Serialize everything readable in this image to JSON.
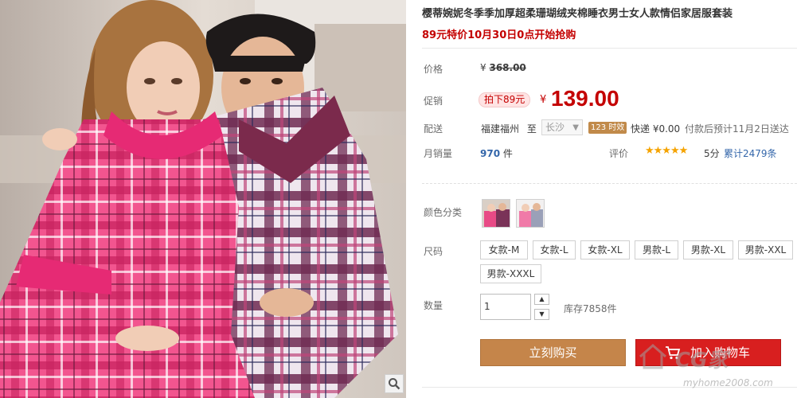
{
  "product": {
    "title": "樱蒂婉妮冬季季加厚超柔珊瑚绒夹棉睡衣男士女人款情侣家居服套装",
    "subtitle": "89元特价10月30日0点开始抢购"
  },
  "price": {
    "label": "价格",
    "currency": "¥",
    "original": "368.00"
  },
  "promo": {
    "label": "促销",
    "tag": "拍下89元",
    "currency": "¥",
    "value": "139.00"
  },
  "shipping": {
    "label": "配送",
    "from": "福建福州",
    "to_prefix": "至",
    "to": "长沙",
    "badge": "123 时效",
    "fee": "快递 ¥0.00",
    "estimate": "付款后预计11月2日送达"
  },
  "sales": {
    "label": "月销量",
    "count": "970",
    "unit": "件",
    "rating_label": "评价",
    "stars": "★★★★★",
    "score": "5分",
    "reviews": "累计2479条"
  },
  "colors": {
    "label": "颜色分类"
  },
  "sizes": {
    "label": "尺码",
    "options": [
      "女款-M",
      "女款-L",
      "女款-XL",
      "男款-L",
      "男款-XL",
      "男款-XXL",
      "男款-XXXL"
    ]
  },
  "quantity": {
    "label": "数量",
    "value": "1",
    "stock": "库存7858件"
  },
  "actions": {
    "buy": "立刻购买",
    "cart": "加入购物车"
  },
  "watermark": {
    "text": "CG家",
    "url": "myhome2008.com"
  },
  "colors_theme": {
    "accent_red": "#c40000",
    "buy_button": "#c5854a",
    "cart_button": "#d81f1f",
    "link_blue": "#3366aa",
    "star": "#f5a300"
  }
}
